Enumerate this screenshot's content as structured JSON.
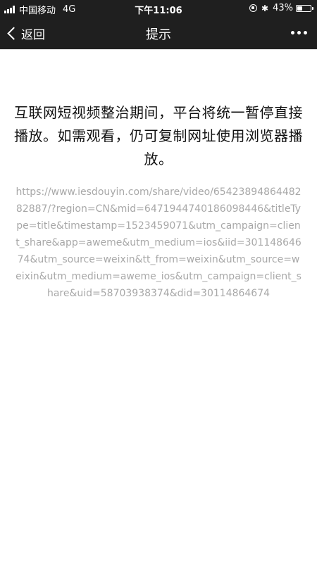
{
  "status_bar": {
    "carrier": "中国移动",
    "network": "4G",
    "time": "下午11:06",
    "battery_percent_label": "43%",
    "battery_level": 0.43,
    "icons": [
      "signal-icon",
      "rotation-lock-icon",
      "bluetooth-icon",
      "battery-icon"
    ]
  },
  "nav": {
    "back_label": "返回",
    "title": "提示",
    "more_icon": "more-icon"
  },
  "content": {
    "message": "互联网短视频整治期间，平台将统一暂停直接播放。如需观看，仍可复制网址使用浏览器播放。",
    "url": "https://www.iesdouyin.com/share/video/6542389486448282887/?region=CN&mid=6471944740186098446&titleType=title&timestamp=1523459071&utm_campaign=client_share&app=aweme&utm_medium=ios&iid=30114864674&utm_source=weixin&tt_from=weixin&utm_source=weixin&utm_medium=aweme_ios&utm_campaign=client_share&uid=58703938374&did=30114864674"
  },
  "colors": {
    "bar_background": "#1f1f1f",
    "message_text": "#111111",
    "url_text": "#a8a8a8"
  }
}
